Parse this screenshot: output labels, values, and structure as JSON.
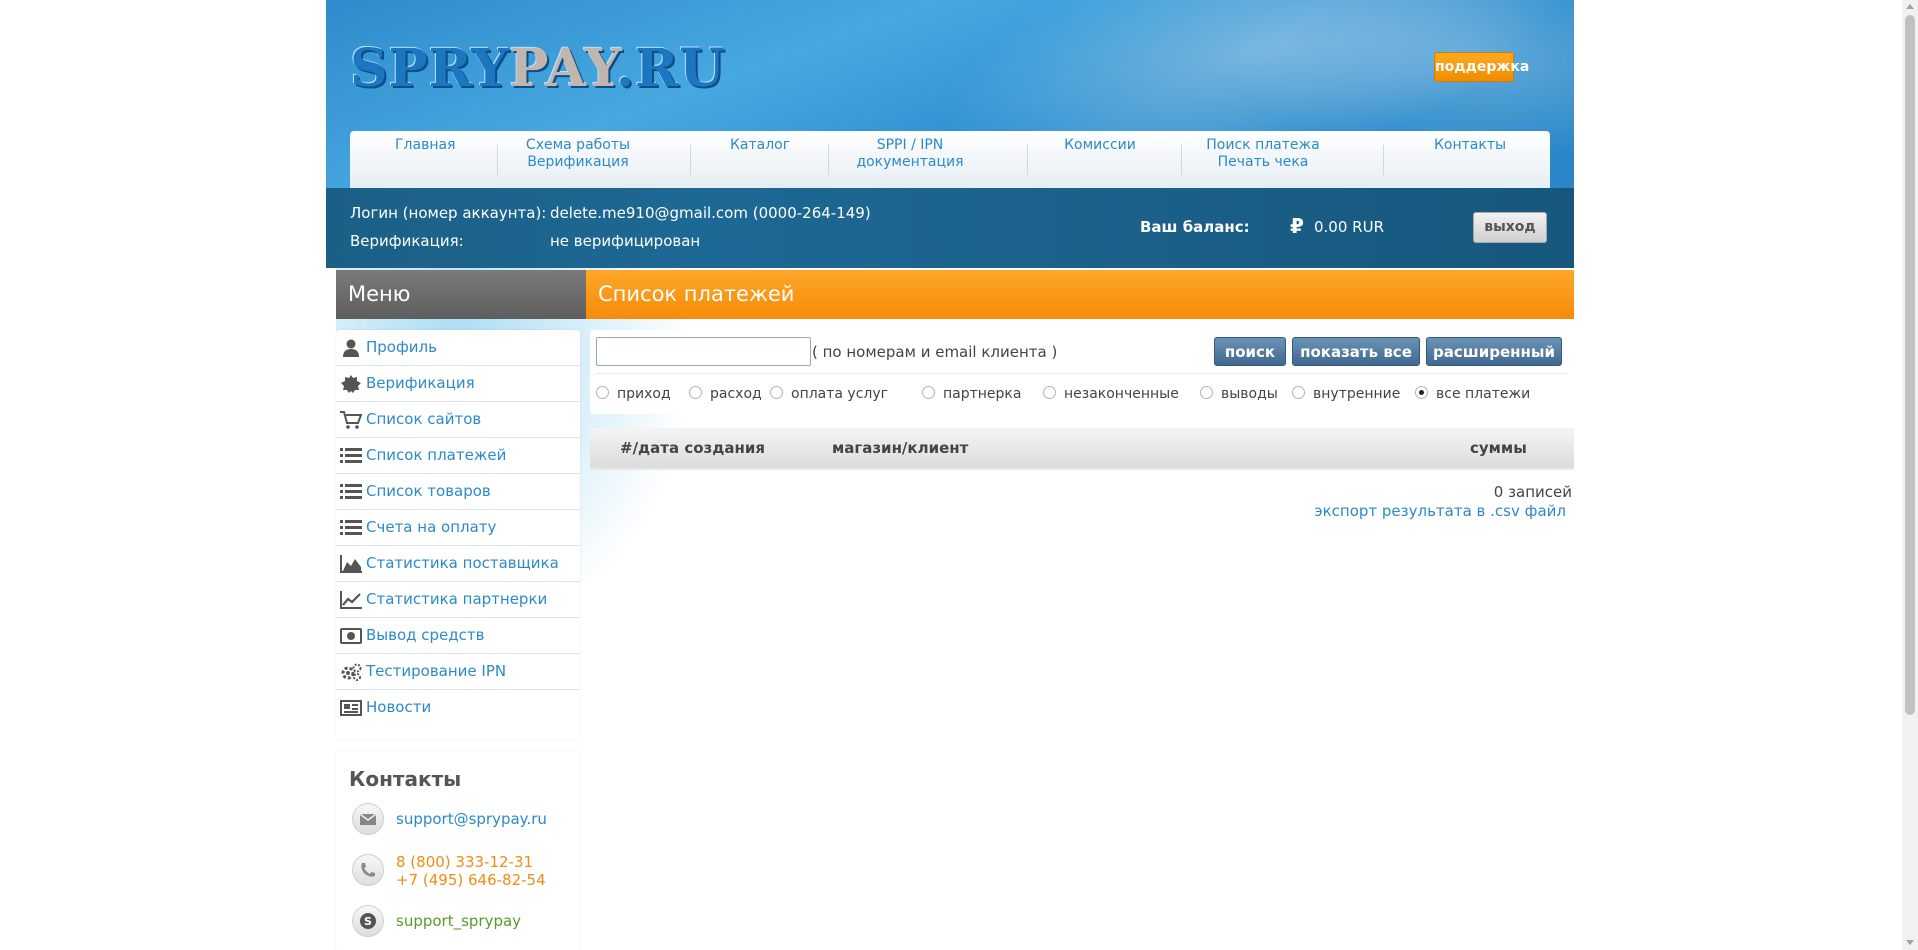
{
  "logo": {
    "part1": "SPRY",
    "part2": "PAY",
    "part3": ".RU"
  },
  "support_button": "поддержка",
  "nav": [
    {
      "line1": "Главная",
      "line2": ""
    },
    {
      "line1": "Схема работы",
      "line2": "Верификация"
    },
    {
      "line1": "Каталог",
      "line2": ""
    },
    {
      "line1": "SPPI / IPN",
      "line2": "документация"
    },
    {
      "line1": "Комиссии",
      "line2": ""
    },
    {
      "line1": "Поиск платежа",
      "line2": "Печать чека"
    },
    {
      "line1": "Контакты",
      "line2": ""
    }
  ],
  "account": {
    "login_label": "Логин (номер аккаунта):",
    "login_value": "delete.me910@gmail.com (0000-264-149)",
    "verification_label": "Верификация:",
    "verification_value": "не верифицирован",
    "balance_label": "Ваш баланс:",
    "balance_value": "0.00  RUR",
    "exit_button": "выход"
  },
  "menu": {
    "title": "Меню",
    "items": [
      {
        "label": "Профиль",
        "icon": "user-icon"
      },
      {
        "label": "Верификация",
        "icon": "badge-icon"
      },
      {
        "label": "Список сайтов",
        "icon": "cart-icon"
      },
      {
        "label": "Список платежей",
        "icon": "list-icon"
      },
      {
        "label": "Список товаров",
        "icon": "list-icon"
      },
      {
        "label": "Счета на оплату",
        "icon": "list-icon"
      },
      {
        "label": "Статистика поставщика",
        "icon": "area-chart-icon"
      },
      {
        "label": "Статистика партнерки",
        "icon": "line-chart-icon"
      },
      {
        "label": "Вывод средств",
        "icon": "money-icon"
      },
      {
        "label": "Тестирование IPN",
        "icon": "gears-icon"
      },
      {
        "label": "Новости",
        "icon": "newspaper-icon"
      }
    ]
  },
  "contacts": {
    "title": "Контакты",
    "email": "support@sprypay.ru",
    "phone1": "8 (800) 333-12-31",
    "phone2": "+7 (495) 646-82-54",
    "skype": "support_sprypay"
  },
  "main": {
    "title": "Список платежей",
    "search_placeholder": "",
    "search_hint": "( по номерам и email клиента )",
    "buttons": {
      "search": "поиск",
      "show_all": "показать все",
      "advanced": "расширенный"
    },
    "filters": [
      {
        "label": "приход",
        "checked": false
      },
      {
        "label": "расход",
        "checked": false
      },
      {
        "label": "оплата услуг",
        "checked": false
      },
      {
        "label": "партнерка",
        "checked": false
      },
      {
        "label": "незаконченные",
        "checked": false
      },
      {
        "label": "выводы",
        "checked": false
      },
      {
        "label": "внутренние",
        "checked": false
      },
      {
        "label": "все платежи",
        "checked": true
      }
    ],
    "columns": {
      "id_date": "#/дата создания",
      "shop_client": "магазин/клиент",
      "sums": "суммы"
    },
    "records": "0 записей",
    "export_link": "экспорт результата в .csv файл"
  },
  "colors": {
    "accent_orange": "#f58b0a",
    "link_blue": "#2c8acb",
    "account_bar": "#1b5f86"
  }
}
